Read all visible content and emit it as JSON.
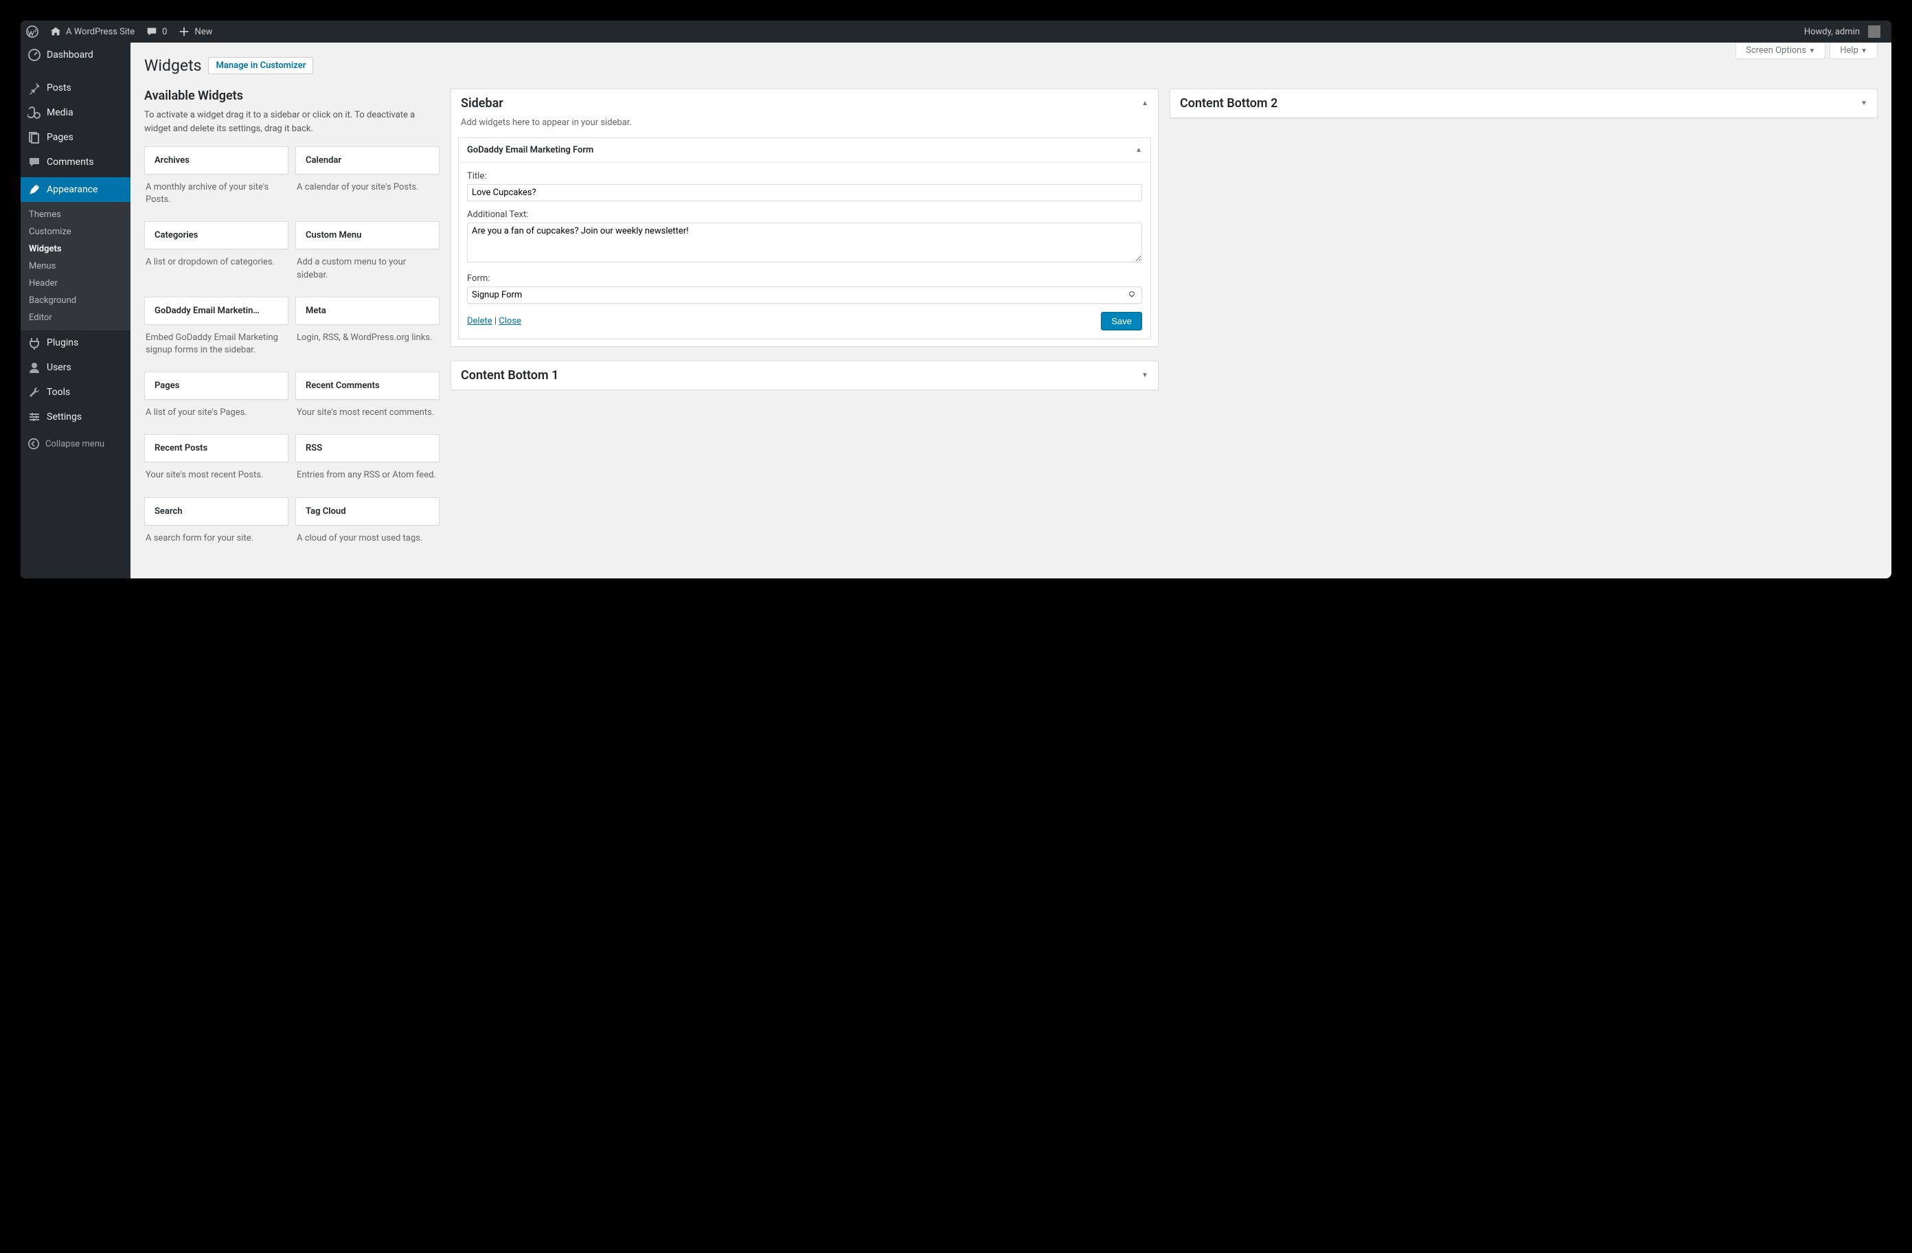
{
  "adminbar": {
    "site_name": "A WordPress Site",
    "comment_count": "0",
    "new_label": "New",
    "howdy": "Howdy, admin"
  },
  "sidebar": {
    "items": [
      {
        "label": "Dashboard"
      },
      {
        "label": "Posts"
      },
      {
        "label": "Media"
      },
      {
        "label": "Pages"
      },
      {
        "label": "Comments"
      },
      {
        "label": "Appearance"
      },
      {
        "label": "Plugins"
      },
      {
        "label": "Users"
      },
      {
        "label": "Tools"
      },
      {
        "label": "Settings"
      }
    ],
    "submenu": [
      {
        "label": "Themes"
      },
      {
        "label": "Customize"
      },
      {
        "label": "Widgets"
      },
      {
        "label": "Menus"
      },
      {
        "label": "Header"
      },
      {
        "label": "Background"
      },
      {
        "label": "Editor"
      }
    ],
    "collapse": "Collapse menu"
  },
  "screen_meta": {
    "screen_options": "Screen Options",
    "help": "Help"
  },
  "page": {
    "title": "Widgets",
    "manage_link": "Manage in Customizer",
    "available_title": "Available Widgets",
    "available_desc": "To activate a widget drag it to a sidebar or click on it. To deactivate a widget and delete its settings, drag it back."
  },
  "widgets": [
    {
      "title": "Archives",
      "desc": "A monthly archive of your site's Posts."
    },
    {
      "title": "Calendar",
      "desc": "A calendar of your site's Posts."
    },
    {
      "title": "Categories",
      "desc": "A list or dropdown of categories."
    },
    {
      "title": "Custom Menu",
      "desc": "Add a custom menu to your sidebar."
    },
    {
      "title": "GoDaddy Email Marketin…",
      "desc": "Embed GoDaddy Email Marketing signup forms in the sidebar."
    },
    {
      "title": "Meta",
      "desc": "Login, RSS, & WordPress.org links."
    },
    {
      "title": "Pages",
      "desc": "A list of your site's Pages."
    },
    {
      "title": "Recent Comments",
      "desc": "Your site's most recent comments."
    },
    {
      "title": "Recent Posts",
      "desc": "Your site's most recent Posts."
    },
    {
      "title": "RSS",
      "desc": "Entries from any RSS or Atom feed."
    },
    {
      "title": "Search",
      "desc": "A search form for your site."
    },
    {
      "title": "Tag Cloud",
      "desc": "A cloud of your most used tags."
    }
  ],
  "areas": {
    "sidebar": {
      "title": "Sidebar",
      "desc": "Add widgets here to appear in your sidebar.",
      "widget": {
        "title": "GoDaddy Email Marketing Form",
        "fields": {
          "title_label": "Title:",
          "title_value": "Love Cupcakes?",
          "text_label": "Additional Text:",
          "text_value": "Are you a fan of cupcakes? Join our weekly newsletter!",
          "form_label": "Form:",
          "form_value": "Signup Form"
        },
        "delete": "Delete",
        "close": "Close",
        "save": "Save"
      }
    },
    "bottom1": {
      "title": "Content Bottom 1"
    },
    "bottom2": {
      "title": "Content Bottom 2"
    }
  }
}
